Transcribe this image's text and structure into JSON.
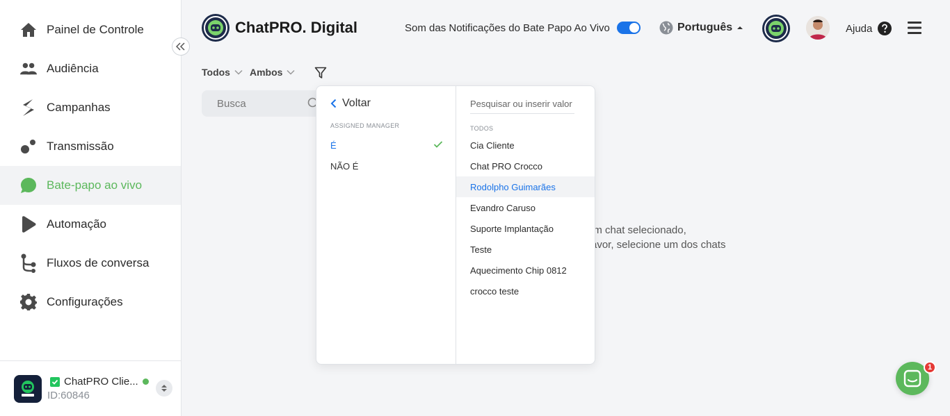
{
  "sidebar": {
    "items": [
      {
        "label": "Painel de Controle",
        "icon": "home-icon"
      },
      {
        "label": "Audiência",
        "icon": "users-icon"
      },
      {
        "label": "Campanhas",
        "icon": "campaign-icon"
      },
      {
        "label": "Transmissão",
        "icon": "broadcast-icon"
      },
      {
        "label": "Bate-papo ao vivo",
        "icon": "chat-bubble-icon",
        "active": true
      },
      {
        "label": "Automação",
        "icon": "automation-icon"
      },
      {
        "label": "Fluxos de conversa",
        "icon": "flow-icon"
      },
      {
        "label": "Configurações",
        "icon": "gear-icon"
      }
    ],
    "account": {
      "name": "ChatPRO Clie...",
      "id": "ID:60846",
      "logo_text": "ChatPRO"
    }
  },
  "header": {
    "brand": "ChatPRO. Digital",
    "notif_label": "Som das Notificações do Bate Papo Ao Vivo",
    "language": "Português",
    "help": "Ajuda"
  },
  "filters": {
    "status": "Todos",
    "type": "Ambos",
    "search_placeholder": "Busca"
  },
  "empty": {
    "line1": "enhum chat selecionado,",
    "line2": "avor, selecione um dos chats"
  },
  "panel": {
    "back": "Voltar",
    "operator_section": "ASSIGNED MANAGER",
    "operators": [
      {
        "label": "É",
        "selected": true
      },
      {
        "label": "NÃO É",
        "selected": false
      }
    ],
    "value_placeholder": "Pesquisar ou inserir valor",
    "values_section": "TODOS",
    "values": [
      "Cia Cliente",
      "Chat PRO Crocco",
      "Rodolpho Guimarães",
      "Evandro Caruso",
      "Suporte Implantação",
      "Teste",
      "Aquecimento Chip 0812",
      "crocco teste"
    ],
    "hovered_index": 2
  },
  "launcher": {
    "badge": "1"
  },
  "colors": {
    "accent_green": "#5cb85c",
    "accent_blue": "#1a73e8"
  }
}
